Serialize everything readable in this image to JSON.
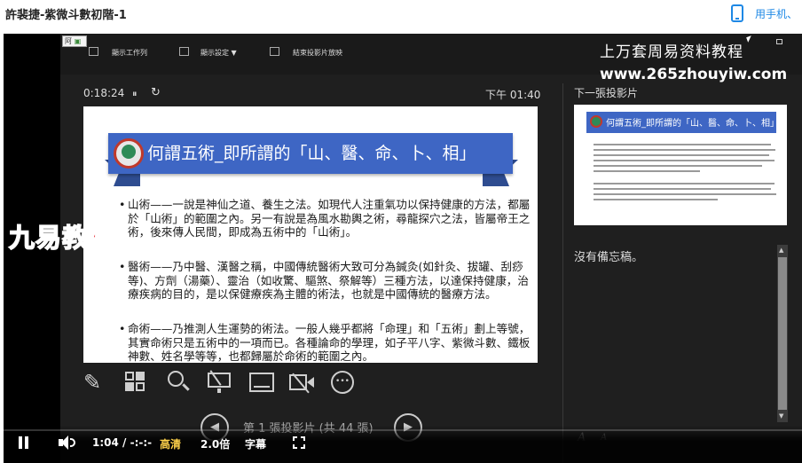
{
  "page": {
    "title": "許裴捷-紫微斗數初階-1",
    "phone_link": "用手机、",
    "icons": {
      "phone": "phone-icon"
    }
  },
  "presenter": {
    "logo_text": "阿",
    "toolbar": [
      {
        "label": "顯示工作列",
        "icon": "taskbar-icon"
      },
      {
        "label": "顯示設定 ▼",
        "icon": "display-settings-icon"
      },
      {
        "label": "結束投影片放映",
        "icon": "end-show-icon"
      }
    ],
    "elapsed": "0:18:24",
    "pause_glyph": "⏸",
    "refresh_glyph": "↻",
    "clock": "下午 01:40",
    "next_slide_label": "下一張投影片",
    "next_slide_title": "何謂五術_即所謂的「山、醫、命、卜、相」",
    "notes_label": "沒有備忘稿。",
    "slide_count": "第 1 張投影片 (共 44 張)",
    "prev_glyph": "◀",
    "next_glyph": "▶",
    "font_increase": "A",
    "font_decrease": "A",
    "scroll_up": "▲",
    "scroll_down": "▼"
  },
  "watermark": {
    "top": "上万套周易资料教程",
    "url": "www.265zhouyiw.com",
    "red": "九易教程"
  },
  "slide": {
    "title": "何謂五術_即所謂的「山、醫、命、卜、相」",
    "bullets": [
      "山術——一說是神仙之道、養生之法。如現代人注重氣功以保持健康的方法，都屬於「山術」的範圍之內。另一有說是為風水勘輿之術，尋龍探穴之法，皆屬帝王之術，後來傳人民間，即成為五術中的「山術」。",
      "醫術——乃中醫、漢醫之稱，中國傳統醫術大致可分為鍼灸(如針灸、拔罐、刮痧等)、方劑（湯藥）、靈治（如收驚、驅煞、祭解等）三種方法，以達保持健康，治療疾病的目的，是以保健療疾為主體的術法，也就是中國傳統的醫療方法。",
      "命術——乃推測人生運勢的術法。一般人幾乎都將「命理」和「五術」劃上等號，其實命術只是五術中的一項而已。各種論命的學理，如子平八字、紫微斗數、鐵板神數、姓名學等等，也都歸屬於命術的範圍之內。"
    ]
  },
  "tools": [
    {
      "name": "pen-icon",
      "glyph": "✎"
    },
    {
      "name": "slide-sorter-icon",
      "glyph": ""
    },
    {
      "name": "zoom-icon",
      "glyph": ""
    },
    {
      "name": "pointer-screen-icon",
      "glyph": ""
    },
    {
      "name": "subtitles-icon",
      "glyph": ""
    },
    {
      "name": "camera-off-icon",
      "glyph": ""
    },
    {
      "name": "more-icon",
      "glyph": "•••"
    }
  ],
  "player": {
    "time": "1:04 / -:-:-",
    "quality": "高清",
    "speed": "2.0倍",
    "subtitle": "字幕",
    "colors": {
      "quality": "#ffd24a",
      "accent": "#1e88e5",
      "ribbon": "#3e66c4",
      "watermark_red": "#e4202a"
    }
  }
}
